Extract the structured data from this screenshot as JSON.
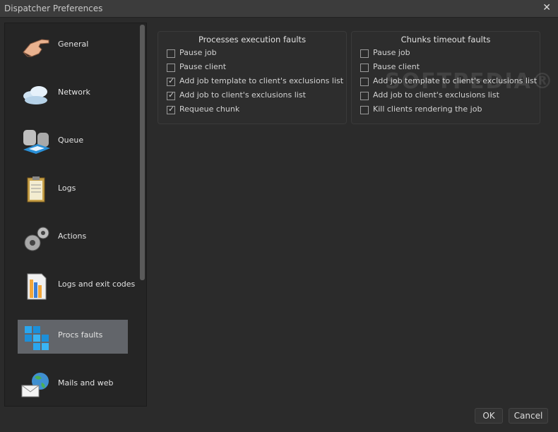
{
  "window": {
    "title": "Dispatcher Preferences"
  },
  "sidebar": {
    "items": [
      {
        "label": "General",
        "icon": "pointing-hand-icon",
        "selected": false
      },
      {
        "label": "Network",
        "icon": "cloud-icon",
        "selected": false
      },
      {
        "label": "Queue",
        "icon": "database-queue-icon",
        "selected": false
      },
      {
        "label": "Logs",
        "icon": "clipboard-icon",
        "selected": false
      },
      {
        "label": "Actions",
        "icon": "gears-icon",
        "selected": false
      },
      {
        "label": "Logs and exit codes",
        "icon": "log-file-icon",
        "selected": false
      },
      {
        "label": "Procs faults",
        "icon": "cubes-icon",
        "selected": true
      },
      {
        "label": "Mails and web",
        "icon": "mail-globe-icon",
        "selected": false
      }
    ]
  },
  "processes_group": {
    "title": "Processes execution faults",
    "options": [
      {
        "label": "Pause job",
        "checked": false
      },
      {
        "label": "Pause client",
        "checked": false
      },
      {
        "label": "Add job template to client's exclusions list",
        "checked": true
      },
      {
        "label": "Add job to client's exclusions list",
        "checked": true
      },
      {
        "label": "Requeue chunk",
        "checked": true
      }
    ]
  },
  "chunks_group": {
    "title": "Chunks timeout faults",
    "options": [
      {
        "label": "Pause job",
        "checked": false
      },
      {
        "label": "Pause client",
        "checked": false
      },
      {
        "label": "Add job template to client's exclusions list",
        "checked": false
      },
      {
        "label": "Add job to client's exclusions list",
        "checked": false
      },
      {
        "label": "Kill clients rendering the job",
        "checked": false
      }
    ]
  },
  "watermark": "SOFTPEDIA®",
  "buttons": {
    "ok": "OK",
    "cancel": "Cancel"
  },
  "colors": {
    "background": "#2b2b2b",
    "selected": "#62656a",
    "sidebar": "#252525"
  }
}
